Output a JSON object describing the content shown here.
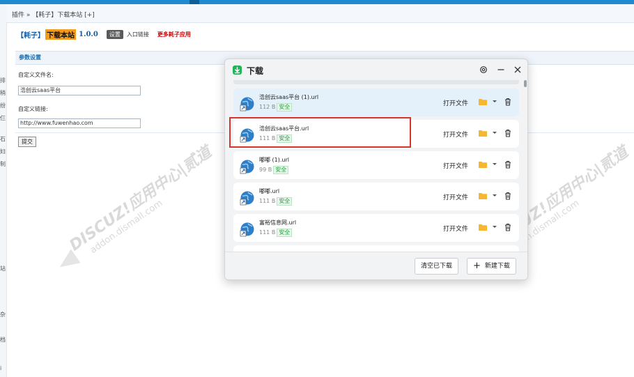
{
  "breadcrumb": "插件 » 【耗子】下载本站 [+]",
  "header": {
    "brand": "【耗子】",
    "highlight": "下载本站",
    "version": "1.0.0",
    "settings_button": "设置",
    "entry_link": "入口链接",
    "more_link": "更多耗子应用"
  },
  "panel": {
    "title": "参数设置",
    "filename_label": "自定义文件名:",
    "filename_value": "浩创云saas平台",
    "link_label": "自定义链接:",
    "link_value": "http://www.fuwenhao.com",
    "submit_label": "提交"
  },
  "left_glyphs": [
    "排",
    "稍",
    "纷",
    "仨",
    "石",
    "妇",
    "制",
    "站",
    "杂",
    "档",
    "ⅰ"
  ],
  "watermark": {
    "line1": "DISCUZ!应用中心|贰道",
    "line2": "addon.dismall.com"
  },
  "dialog": {
    "title": "下载",
    "items": [
      {
        "name": "浩创云saas平台 (1).url",
        "size": "112 B",
        "badge": "安全",
        "open": "打开文件"
      },
      {
        "name": "浩创云saas平台.url",
        "size": "111 B",
        "badge": "安全",
        "open": "打开文件"
      },
      {
        "name": "嘟嘟 (1).url",
        "size": "99 B",
        "badge": "安全",
        "open": "打开文件"
      },
      {
        "name": "嘟嘟.url",
        "size": "111 B",
        "badge": "安全",
        "open": "打开文件"
      },
      {
        "name": "富裕信息网.url",
        "size": "111 B",
        "badge": "安全",
        "open": "打开文件"
      }
    ],
    "clear_button": "清空已下载",
    "new_button": "新建下载"
  },
  "colors": {
    "topbar": "#1f8ad0",
    "brand_blue": "#1560a8",
    "highlight_orange": "#f29c1f",
    "more_red": "#d00000",
    "safe_green": "#2f9e44",
    "selection_box": "#d9342b",
    "download_icon": "#21b35a",
    "folder_yellow": "#f5b731"
  },
  "icons": [
    "download-app-icon",
    "settings-gear-icon",
    "minimize-icon",
    "close-icon",
    "url-globe-icon",
    "folder-icon",
    "chevron-down-icon",
    "trash-icon",
    "plus-icon"
  ]
}
